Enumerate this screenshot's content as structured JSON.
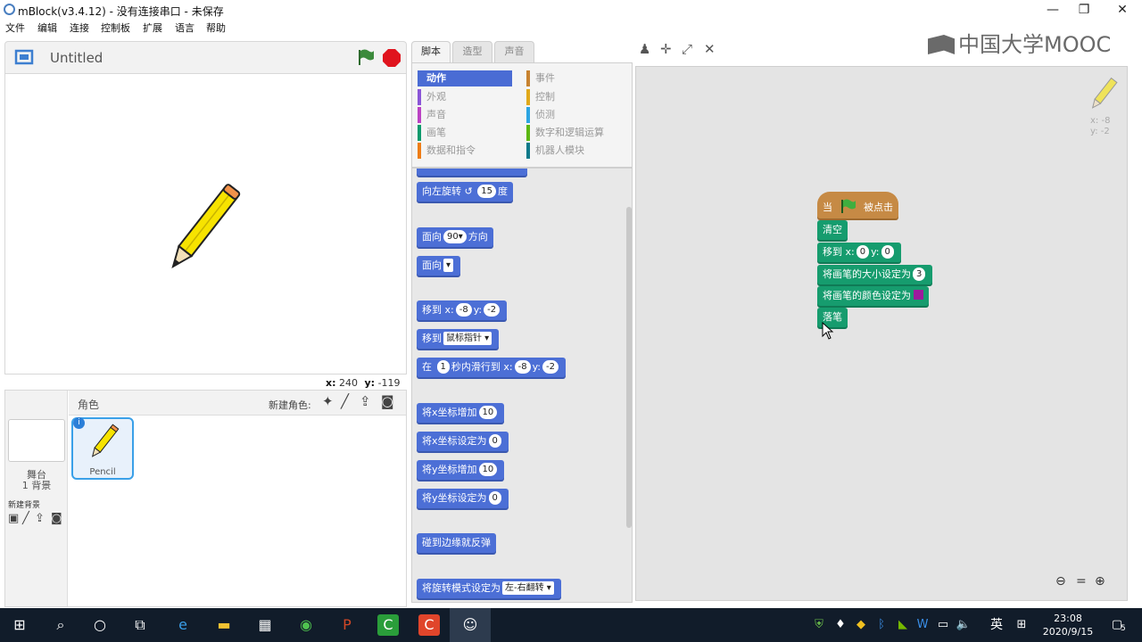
{
  "window": {
    "title": "mBlock(v3.4.12) - 没有连接串口 - 未保存",
    "minimize": "—",
    "maximize": "❐",
    "close": "✕"
  },
  "menu": [
    "文件",
    "编辑",
    "连接",
    "控制板",
    "扩展",
    "语言",
    "帮助"
  ],
  "stage": {
    "title": "Untitled",
    "coords": {
      "x_label": "x:",
      "x": "240",
      "y_label": "y:",
      "y": "-119"
    }
  },
  "sprites": {
    "header": "角色",
    "new_sprite": "新建角色:",
    "stage_label": "舞台",
    "backdrops": "1 背景",
    "new_backdrop": "新建背景",
    "sprite_name": "Pencil"
  },
  "tabs": [
    "脚本",
    "造型",
    "声音"
  ],
  "categories": {
    "left": [
      {
        "label": "动作",
        "color": "#4a6cd4"
      },
      {
        "label": "外观",
        "color": "#8a55d7"
      },
      {
        "label": "声音",
        "color": "#bb42c3"
      },
      {
        "label": "画笔",
        "color": "#0e9a6c"
      },
      {
        "label": "数据和指令",
        "color": "#ee7d16"
      }
    ],
    "right": [
      {
        "label": "事件",
        "color": "#c88330"
      },
      {
        "label": "控制",
        "color": "#e1a91a"
      },
      {
        "label": "侦测",
        "color": "#2ca5e2"
      },
      {
        "label": "数字和逻辑运算",
        "color": "#5cb712"
      },
      {
        "label": "机器人模块",
        "color": "#0e7a8a"
      }
    ]
  },
  "palette": {
    "turn_left": "向左旋转",
    "turn_deg": "15",
    "degrees": "度",
    "point_in": "面向",
    "point_val": "90▾",
    "direction": "方向",
    "point_towards": "面向",
    "point_drop": "▾",
    "goto": "移到",
    "x_label": "x:",
    "y_label": "y:",
    "goto_x": "-8",
    "goto_y": "-2",
    "goto_target": "移到",
    "mouse_pointer": "鼠标指针 ▾",
    "glide_in": "在",
    "glide_secs": "1",
    "glide_text": "秒内滑行到",
    "change_x": "将x坐标增加",
    "change_x_val": "10",
    "set_x": "将x坐标设定为",
    "set_x_val": "0",
    "change_y": "将y坐标增加",
    "change_y_val": "10",
    "set_y": "将y坐标设定为",
    "set_y_val": "0",
    "bounce": "碰到边缘就反弹",
    "rotation_style": "将旋转模式设定为",
    "rotation_val": "左-右翻转 ▾"
  },
  "script": {
    "when": "当",
    "clicked": "被点击",
    "clear": "清空",
    "goto": "移到",
    "x_label": "x:",
    "x": "0",
    "y_label": "y:",
    "y": "0",
    "pen_size": "将画笔的大小设定为",
    "pen_size_val": "3",
    "pen_color": "将画笔的颜色设定为",
    "pen_down": "落笔",
    "mini_x": "x: -8",
    "mini_y": "y: -2"
  },
  "watermark": "中国大学MOOC",
  "taskbar": {
    "ime": "英",
    "time": "23:08",
    "date": "2020/9/15",
    "notify": "5"
  }
}
